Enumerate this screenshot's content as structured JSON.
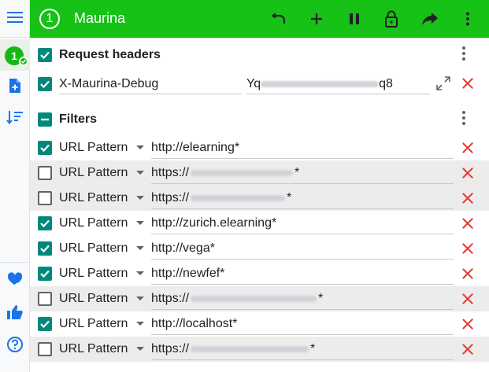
{
  "app": {
    "profile_number": "1",
    "profile_name": "Maurina",
    "accent": "#17c217"
  },
  "toolbar": {
    "icons": [
      "undo-icon",
      "add-icon",
      "pause-icon",
      "lock-icon",
      "share-icon",
      "more-vert-icon"
    ]
  },
  "sidebar": {
    "top": [
      "menu-icon",
      "profile-badge",
      "add-profile-icon",
      "sort-icon"
    ],
    "bottom": [
      "donate-icon",
      "thumbs-up-icon",
      "help-icon"
    ],
    "badge_number": "1"
  },
  "request_headers": {
    "title": "Request headers",
    "checked": true,
    "items": [
      {
        "enabled": true,
        "name": "X-Maurina-Debug",
        "value_prefix": "Yq",
        "value_suffix": "q8"
      }
    ]
  },
  "filters": {
    "title": "Filters",
    "items": [
      {
        "enabled": true,
        "type": "URL Pattern",
        "prefix": "http://elearning*",
        "suffix": "",
        "shaded": false
      },
      {
        "enabled": false,
        "type": "URL Pattern",
        "prefix": "https://",
        "suffix": "*",
        "shaded": true
      },
      {
        "enabled": false,
        "type": "URL Pattern",
        "prefix": "https://",
        "suffix": "*",
        "shaded": true
      },
      {
        "enabled": true,
        "type": "URL Pattern",
        "prefix": "http://zurich.elearning*",
        "suffix": "",
        "shaded": false
      },
      {
        "enabled": true,
        "type": "URL Pattern",
        "prefix": "http://vega*",
        "suffix": "",
        "shaded": false
      },
      {
        "enabled": true,
        "type": "URL Pattern",
        "prefix": "http://newfef*",
        "suffix": "",
        "shaded": false
      },
      {
        "enabled": false,
        "type": "URL Pattern",
        "prefix": "https://",
        "suffix": "*",
        "shaded": true
      },
      {
        "enabled": true,
        "type": "URL Pattern",
        "prefix": "http://localhost*",
        "suffix": "",
        "shaded": false
      },
      {
        "enabled": false,
        "type": "URL Pattern",
        "prefix": "https://",
        "suffix": "*",
        "shaded": true
      }
    ]
  }
}
